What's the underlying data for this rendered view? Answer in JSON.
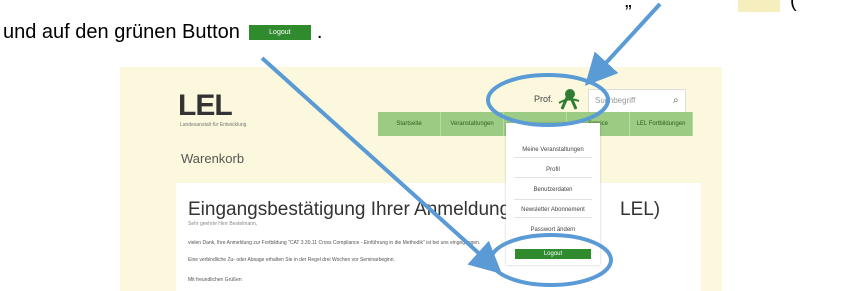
{
  "instructions": {
    "line1_quote_fragment": "„",
    "line1_paren_fragment": "(",
    "line2_text": "und auf den grünen Button",
    "line2_button_label": "Logout",
    "line2_end": "."
  },
  "screenshot": {
    "logo": "LEL",
    "logo_subtitle": "Landesanstalt für Entwicklung",
    "header_user": "Prof.",
    "search_placeholder": "Suchbegriff",
    "nav_items": [
      "Startseite",
      "Veranstaltungen",
      "",
      "Service",
      "LEL Fortbildungen"
    ],
    "cart_title": "Warenkorb",
    "heading": "Eingangsbestätigung Ihrer Anmeldung im Bildungsportal (LEL)",
    "heading_visible": "Eingangsbestätigung Ihrer Anmel",
    "heading_tail": "LEL)",
    "heading_mid": "dung im Bil",
    "subline": "Sehr geehrte Herr Bestelmann,",
    "para1": "vielen Dank, Ihre Anmeldung zur Fortbildung \"CAT 3.30.11 Cross Compliance - Einführung in die Methodik\" ist bei uns eingegangen.",
    "para2": "Eine verbindliche Zu- oder Absage erhalten Sie in der Regel drei Wochen vor Seminarbeginn.",
    "para3": "Mit freundlichen Grüßen",
    "dropdown_items": [
      "Meine Veranstaltungen",
      "Profil",
      "Benutzerdaten",
      "Newsletter Abonnement",
      "Passwort ändern",
      "Logout"
    ]
  },
  "annotation_colors": {
    "arrow_blue": "#5b9bd5",
    "logout_green": "#2f8b2e"
  }
}
